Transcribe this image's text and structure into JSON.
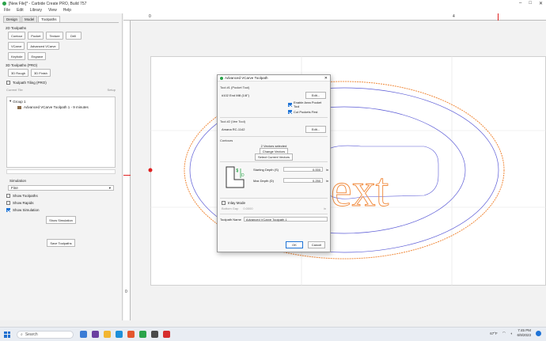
{
  "window": {
    "title": "[New File]* - Carbide Create PRO, Build 757",
    "controls": [
      "–",
      "□",
      "✕"
    ]
  },
  "menu": [
    "File",
    "Edit",
    "Library",
    "View",
    "Help"
  ],
  "left": {
    "tabs": [
      "Design",
      "Model",
      "Toolpaths"
    ],
    "toolpaths_2d_header": "2D Toolpaths",
    "buttons_2d": [
      "Contour",
      "Pocket",
      "Texture",
      "Drill",
      "VCarve",
      "Advanced VCarve",
      "Keyhole",
      "Engrave"
    ],
    "toolpaths_3d_header": "3D Toolpaths (PRO)",
    "buttons_3d": [
      "3D Rough",
      "3D Finish"
    ],
    "tiling_label": "Toolpath Tiling (PRO)",
    "current_tile": "Current Tile",
    "setup": "Setup",
    "group_label": "Group 1",
    "toolpath_item": "Advanced VCarve Toolpath 1 - 9 minutes",
    "simulation_header": "Simulation",
    "sim_select": "Fine",
    "show_toolpaths": "Show Toolpaths",
    "show_rapids": "Show Rapids",
    "show_simulation": "Show Simulation",
    "show_simulation_btn": "Show Simulation",
    "save_toolpaths_btn": "Save Toolpaths"
  },
  "ruler": {
    "top_labels": [
      "0",
      "4"
    ],
    "left_label": "0"
  },
  "dialog": {
    "title": "Advanced VCarve Toolpath",
    "tool1_header": "Tool #1 (Pocket Tool)",
    "tool1_name": "#102 End Mill (1/8\")",
    "edit": "Edit...",
    "enable_area_pocket": "Enable Area Pocket Tool",
    "cut_pockets_first": "Cut Pockets First",
    "tool2_header": "Tool #2 (Vee Tool)",
    "tool2_name": "Amana RC-1142",
    "contours_header": "Contours",
    "vectors_selected": "2 Vectors selected",
    "change_vectors": "Change Vectors",
    "select_current": "Select Current Vectors",
    "start_depth_label": "Starting Depth (S)",
    "start_depth": "0.000",
    "max_depth_label": "Max Depth (D)",
    "max_depth": "0.250",
    "unit": "in",
    "inlay_mode": "Inlay Mode",
    "bottom_gap_label": "Bottom Gap",
    "bottom_gap": "0.0000",
    "toolpath_name_label": "Toolpath Name",
    "toolpath_name": "Advanced VCarve Toolpath 1",
    "ok": "OK",
    "cancel": "Cancel",
    "diagram_s": "S",
    "diagram_d": "D"
  },
  "design": {
    "text": "ext"
  },
  "taskbar": {
    "search": "Search",
    "weather": "67°F",
    "time": "7:45 PM",
    "date": "6/9/2023"
  },
  "colors": {
    "accent": "#1e73d6",
    "toolpath_orange": "#f08a3c",
    "vector_blue": "#5b5bd6",
    "ruler_red": "#e02020"
  }
}
